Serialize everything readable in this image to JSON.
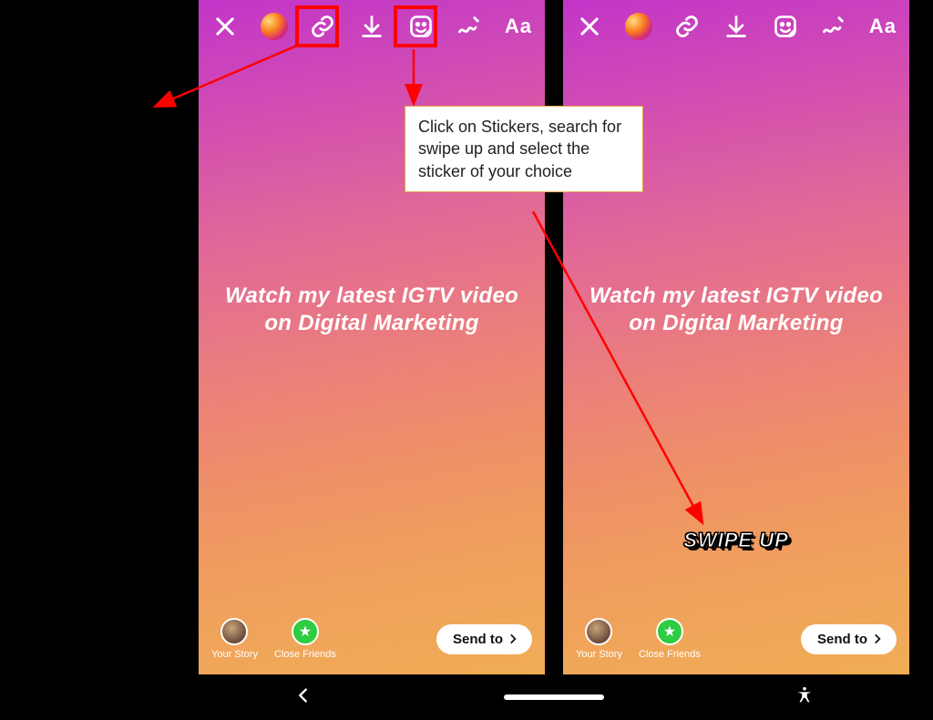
{
  "story": {
    "body_text": "Watch my latest IGTV video on Digital Marketing"
  },
  "toolbar": {
    "text_tool_label": "Aa"
  },
  "swipe_sticker": {
    "text": "SWIPE UP"
  },
  "destinations": {
    "your_story": "Your Story",
    "close_friends": "Close Friends"
  },
  "send_button": {
    "label": "Send to"
  },
  "callout": {
    "text": "Click on Stickers, search for swipe up and select the sticker of your choice"
  },
  "icons": {
    "close": "close-icon",
    "camera": "camera-circle-icon",
    "link": "link-icon",
    "download": "download-icon",
    "sticker": "sticker-icon",
    "draw": "draw-icon",
    "text": "text-icon",
    "star": "star-icon",
    "chevron": "chevron-right-icon",
    "back": "back-icon",
    "home": "home-pill-icon",
    "a11y": "accessibility-icon"
  }
}
